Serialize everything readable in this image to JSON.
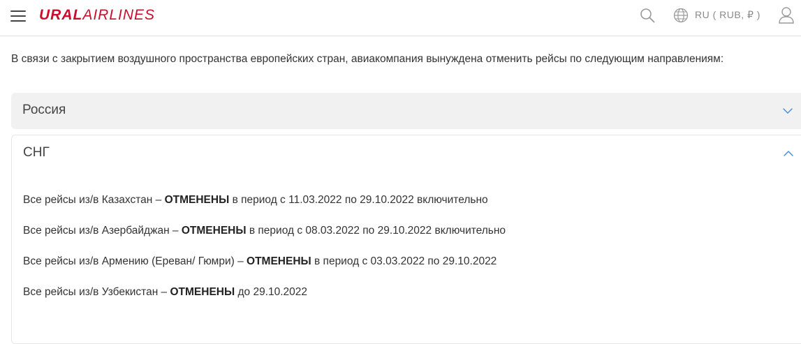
{
  "header": {
    "logo_bold": "URAL",
    "logo_light": "AIRLINES",
    "lang_currency": "RU ( RUB, ₽ )",
    "icons": {
      "menu": "hamburger-menu-icon",
      "search": "search-icon",
      "globe": "globe-icon",
      "user": "user-icon"
    },
    "colors": {
      "brand": "#c8102e",
      "icon": "#9a9a9a"
    }
  },
  "intro_text": "В связи с закрытием воздушного пространства европейских стран, авиакомпания вынуждена отменить рейсы по следующим направлениям:",
  "accordion": {
    "sections": [
      {
        "title": "Россия",
        "expanded": false
      },
      {
        "title": "СНГ",
        "expanded": true
      }
    ],
    "chevron_color": "#4a90d9"
  },
  "cis_flights": [
    {
      "prefix": "Все рейсы из/в Казахстан – ",
      "status": "ОТМЕНЕНЫ",
      "suffix": " в период с 11.03.2022 по 29.10.2022 включительно"
    },
    {
      "prefix": "Все рейсы из/в Азербайджан – ",
      "status": "ОТМЕНЕНЫ",
      "suffix": " в период с 08.03.2022 по 29.10.2022 включительно"
    },
    {
      "prefix": "Все рейсы из/в Армению (Ереван/ Гюмри) – ",
      "status": "ОТМЕНЕНЫ",
      "suffix": " в период с 03.03.2022 по 29.10.2022"
    },
    {
      "prefix": "Все рейсы из/в Узбекистан – ",
      "status": "ОТМЕНЕНЫ",
      "suffix": " до 29.10.2022"
    }
  ]
}
